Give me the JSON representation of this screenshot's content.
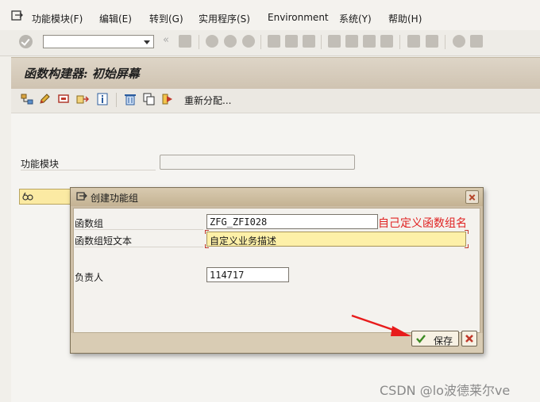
{
  "menu": {
    "items": [
      "功能模块(F)",
      "编辑(E)",
      "转到(G)",
      "实用程序(S)",
      "Environment",
      "系统(Y)",
      "帮助(H)"
    ]
  },
  "page": {
    "title": "函数构建器: 初始屏幕"
  },
  "app_toolbar": {
    "reassign_label": "重新分配..."
  },
  "main": {
    "function_module_label": "功能模块",
    "function_module_value": ""
  },
  "dialog": {
    "title": "创建功能组",
    "fields": {
      "group_label": "函数组",
      "group_value": "ZFG_ZFI028",
      "short_text_label": "函数组短文本",
      "short_text_value": "自定义业务描述",
      "owner_label": "负责人",
      "owner_value": "114717"
    },
    "save_label": "保存"
  },
  "annotation": {
    "text": "自己定义函数组名",
    "color": "#e02222"
  },
  "watermark": "CSDN @lo波德莱尔ve",
  "colors": {
    "title_bar": "#d8cfc0",
    "active_field": "#fdf0a8",
    "dialog_frame": "#cdbea6"
  }
}
